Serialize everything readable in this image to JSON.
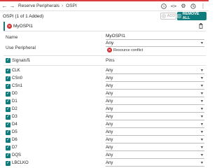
{
  "breadcrumb": {
    "items": [
      "Reserve Peripherals",
      "OSPI"
    ]
  },
  "header": {
    "title": "OSPI (1 of 1 Added)",
    "add_label": "ADD",
    "remove_all_label": "REMOVE ALL"
  },
  "instance": {
    "name": "MyOSPI1"
  },
  "form": {
    "name_label": "Name",
    "name_value": "MyOSPI1",
    "use_peripheral_label": "Use Peripheral",
    "use_peripheral_value": "Any",
    "conflict_text": "Resource conflict"
  },
  "table": {
    "signals_header": "Signals",
    "pins_header": "Pins",
    "rows": [
      {
        "signal": "CLK",
        "pin": "Any"
      },
      {
        "signal": "CSn0",
        "pin": "Any"
      },
      {
        "signal": "CSn1",
        "pin": "Any"
      },
      {
        "signal": "D0",
        "pin": "Any"
      },
      {
        "signal": "D1",
        "pin": "Any"
      },
      {
        "signal": "D2",
        "pin": "Any"
      },
      {
        "signal": "D3",
        "pin": "Any"
      },
      {
        "signal": "D4",
        "pin": "Any"
      },
      {
        "signal": "D5",
        "pin": "Any"
      },
      {
        "signal": "D6",
        "pin": "Any"
      },
      {
        "signal": "D7",
        "pin": "Any"
      },
      {
        "signal": "DQS",
        "pin": "Any"
      },
      {
        "signal": "LBCLKO",
        "pin": "Any"
      }
    ]
  },
  "colors": {
    "accent": "#0e7c7c",
    "error": "#d32f2f",
    "top_strip": "#d93c3c"
  }
}
